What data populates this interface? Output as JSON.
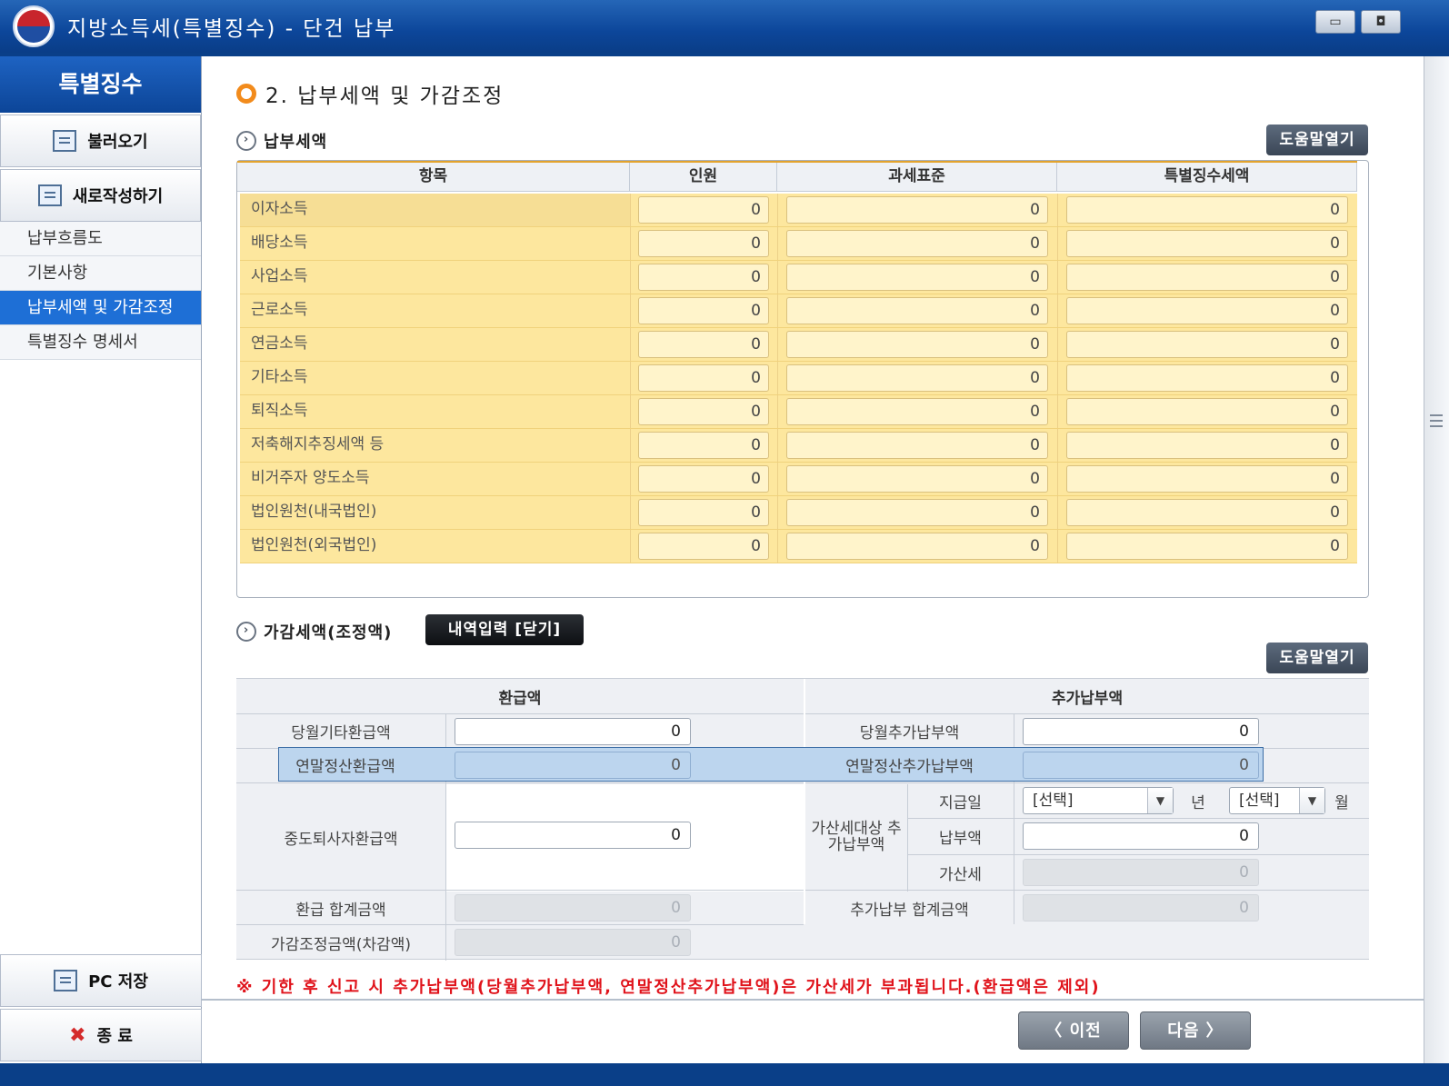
{
  "window": {
    "title": "지방소득세(특별징수) - 단건 납부",
    "minimize_glyph": "▭",
    "restore_glyph": "◘"
  },
  "sidebar": {
    "header": "특별징수",
    "load_button": "불러오기",
    "new_button": "새로작성하기",
    "items": [
      {
        "label": "납부흐름도"
      },
      {
        "label": "기본사항"
      },
      {
        "label": "납부세액 및 가감조정"
      },
      {
        "label": "특별징수 명세서"
      }
    ],
    "active_index": 2,
    "save_button": "PC 저장",
    "exit_button": "종 료"
  },
  "section": {
    "title": "2. 납부세액 및 가감조정"
  },
  "tax": {
    "subtitle": "납부세액",
    "help_label": "도움말열기",
    "headers": [
      "항목",
      "인원",
      "과세표준",
      "특별징수세액"
    ],
    "rows": [
      {
        "label": "이자소득",
        "count": "0",
        "base": "0",
        "tax": "0"
      },
      {
        "label": "배당소득",
        "count": "0",
        "base": "0",
        "tax": "0"
      },
      {
        "label": "사업소득",
        "count": "0",
        "base": "0",
        "tax": "0"
      },
      {
        "label": "근로소득",
        "count": "0",
        "base": "0",
        "tax": "0"
      },
      {
        "label": "연금소득",
        "count": "0",
        "base": "0",
        "tax": "0"
      },
      {
        "label": "기타소득",
        "count": "0",
        "base": "0",
        "tax": "0"
      },
      {
        "label": "퇴직소득",
        "count": "0",
        "base": "0",
        "tax": "0"
      },
      {
        "label": "저축해지추징세액 등",
        "count": "0",
        "base": "0",
        "tax": "0"
      },
      {
        "label": "비거주자 양도소득",
        "count": "0",
        "base": "0",
        "tax": "0"
      },
      {
        "label": "법인원천(내국법인)",
        "count": "0",
        "base": "0",
        "tax": "0"
      },
      {
        "label": "법인원천(외국법인)",
        "count": "0",
        "base": "0",
        "tax": "0"
      }
    ]
  },
  "adjust": {
    "subtitle": "가감세액(조정액)",
    "detail_button": "내역입력 [닫기]",
    "help_label": "도움말열기",
    "refund_header": "환급액",
    "additional_header": "추가납부액",
    "monthly_refund_label": "당월기타환급액",
    "monthly_refund_value": "0",
    "yearend_refund_label": "연말정산환급액",
    "yearend_refund_value": "0",
    "midterm_refund_label": "중도퇴사자환급액",
    "midterm_refund_value": "0",
    "refund_total_label": "환급 합계금액",
    "refund_total_value": "0",
    "adjust_total_label": "가감조정금액(차감액)",
    "adjust_total_value": "0",
    "monthly_add_label": "당월추가납부액",
    "monthly_add_value": "0",
    "yearend_add_label": "연말정산추가납부액",
    "yearend_add_value": "0",
    "penalty_group_label": "가산세대상 추가납부액",
    "pay_date_label": "지급일",
    "year_select": "[선택]",
    "year_unit": "년",
    "month_select": "[선택]",
    "month_unit": "월",
    "pay_amount_label": "납부액",
    "pay_amount_value": "0",
    "penalty_label": "가산세",
    "penalty_value": "0",
    "add_total_label": "추가납부 합계금액",
    "add_total_value": "0"
  },
  "notice": "※ 기한 후 신고 시 추가납부액(당월추가납부액, 연말정산추가납부액)은 가산세가 부과됩니다.(환급액은 제외)",
  "nav": {
    "prev": "〈 이전",
    "next": "다음 〉"
  },
  "colors": {
    "title_bar": "#0c469a",
    "active_item": "#1e6fd6",
    "tax_row": "#fde79e",
    "notice": "#e0131b"
  }
}
